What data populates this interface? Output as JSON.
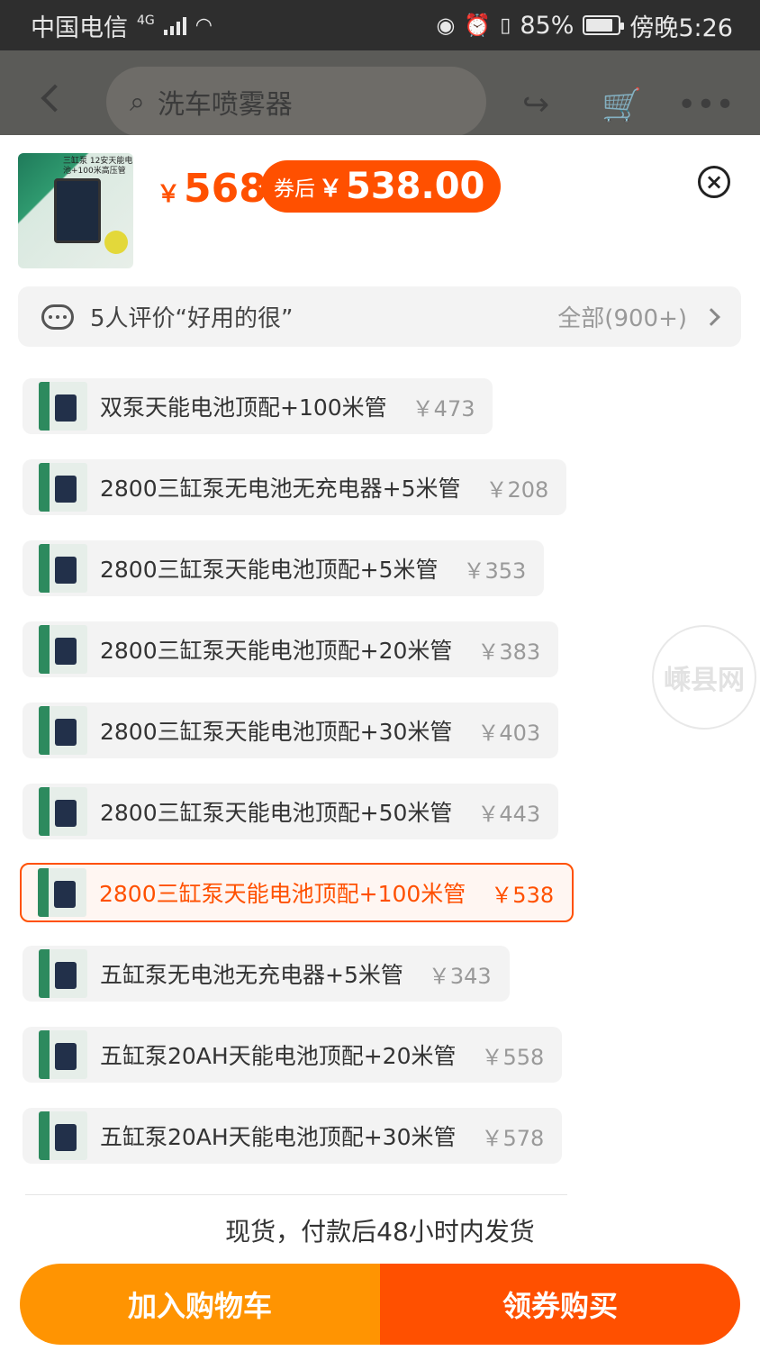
{
  "status_bar": {
    "carrier": "中国电信",
    "network": "4G",
    "battery": "85%",
    "battery_level": 0.85,
    "time": "傍晚5:26"
  },
  "header": {
    "search_placeholder": "洗车喷雾器"
  },
  "product": {
    "price_symbol": "￥",
    "price": "568",
    "coupon_label": "券后",
    "coupon_symbol": "￥",
    "coupon_price": "538.00",
    "thumb_caption": "三缸泵 12安天能电池+100米高压管"
  },
  "reviews": {
    "summary": "5人评价“好用的很”",
    "all_label": "全部(900+)"
  },
  "skus": [
    {
      "name": "双泵天能电池顶配+100米管",
      "price": "￥473",
      "selected": false
    },
    {
      "name": "2800三缸泵无电池无充电器+5米管",
      "price": "￥208",
      "selected": false
    },
    {
      "name": "2800三缸泵天能电池顶配+5米管",
      "price": "￥353",
      "selected": false
    },
    {
      "name": "2800三缸泵天能电池顶配+20米管",
      "price": "￥383",
      "selected": false
    },
    {
      "name": "2800三缸泵天能电池顶配+30米管",
      "price": "￥403",
      "selected": false
    },
    {
      "name": "2800三缸泵天能电池顶配+50米管",
      "price": "￥443",
      "selected": false
    },
    {
      "name": "2800三缸泵天能电池顶配+100米管",
      "price": "￥538",
      "selected": true
    },
    {
      "name": "五缸泵无电池无充电器+5米管",
      "price": "￥343",
      "selected": false
    },
    {
      "name": "五缸泵20AH天能电池顶配+20米管",
      "price": "￥558",
      "selected": false
    },
    {
      "name": "五缸泵20AH天能电池顶配+30米管",
      "price": "￥578",
      "selected": false
    }
  ],
  "shipping_note": "现货，付款后48小时内发货",
  "actions": {
    "add_to_cart": "加入购物车",
    "buy_with_coupon": "领券购买"
  },
  "watermark": "嵊县网",
  "colors": {
    "accent": "#ff5000",
    "cart_button": "#ff9402"
  }
}
